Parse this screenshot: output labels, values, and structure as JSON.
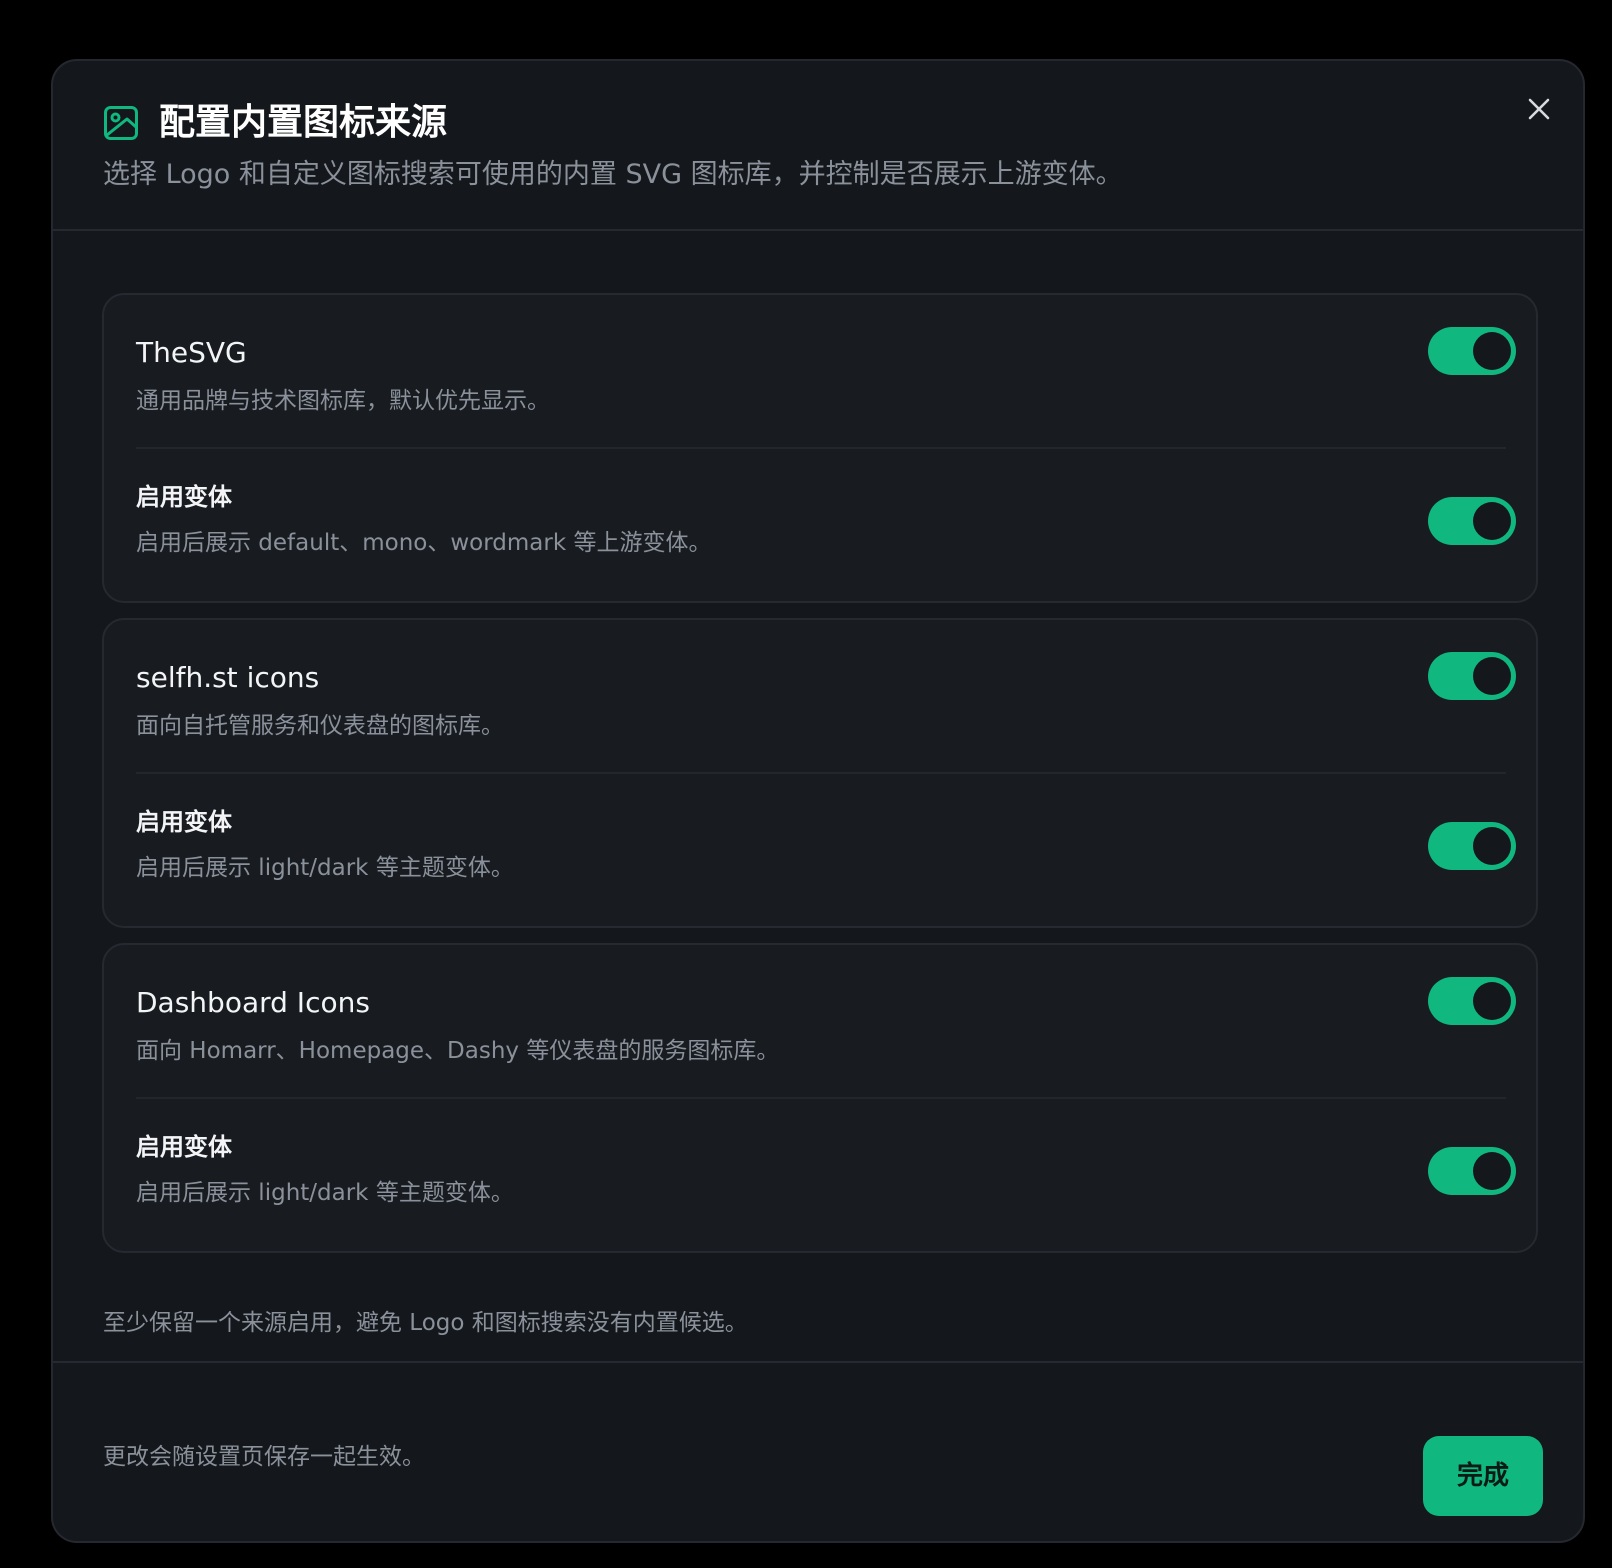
{
  "dialog": {
    "title": "配置内置图标来源",
    "subtitle": "选择 Logo 和自定义图标搜索可使用的内置 SVG 图标库，并控制是否展示上游变体。",
    "close_icon": "close-icon",
    "title_icon": "image-icon"
  },
  "sources": [
    {
      "name": "TheSVG",
      "description": "通用品牌与技术图标库，默认优先显示。",
      "enabled": true,
      "variant_label": "启用变体",
      "variant_description": "启用后展示 default、mono、wordmark 等上游变体。",
      "variant_enabled": true
    },
    {
      "name": "selfh.st icons",
      "description": "面向自托管服务和仪表盘的图标库。",
      "enabled": true,
      "variant_label": "启用变体",
      "variant_description": "启用后展示 light/dark 等主题变体。",
      "variant_enabled": true
    },
    {
      "name": "Dashboard Icons",
      "description": "面向 Homarr、Homepage、Dashy 等仪表盘的服务图标库。",
      "enabled": true,
      "variant_label": "启用变体",
      "variant_description": "启用后展示 light/dark 等主题变体。",
      "variant_enabled": true
    }
  ],
  "hint": "至少保留一个来源启用，避免 Logo 和图标搜索没有内置候选。",
  "footer": {
    "note": "更改会随设置页保存一起生效。",
    "done_label": "完成"
  },
  "colors": {
    "accent": "#10b77f",
    "background": "#14171b",
    "card": "#181b20",
    "border": "#262a30",
    "muted_text": "#8a919b"
  }
}
